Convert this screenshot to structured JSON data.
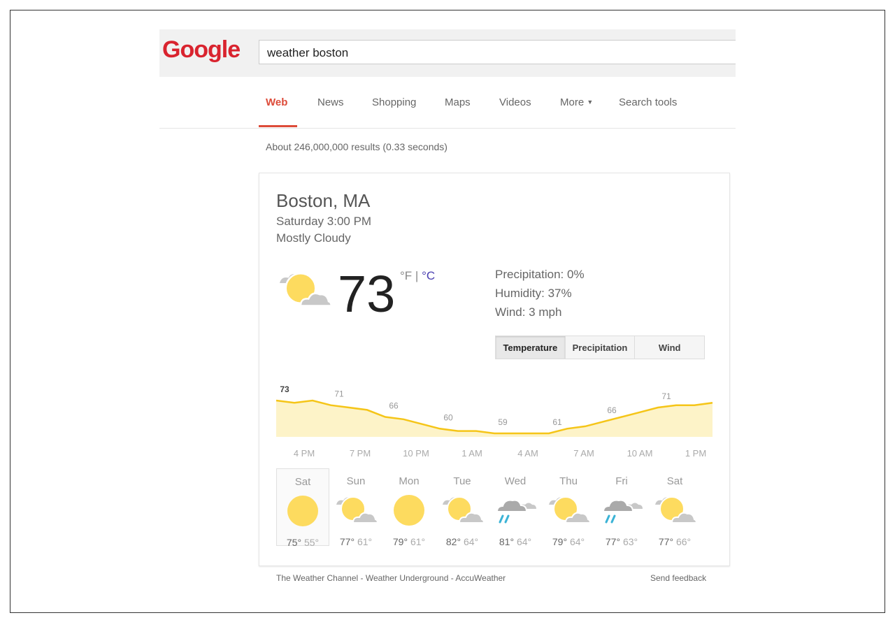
{
  "logo": {
    "text": "Google"
  },
  "search": {
    "query": "weather boston"
  },
  "nav": {
    "items": [
      "Web",
      "News",
      "Shopping",
      "Maps",
      "Videos",
      "More",
      "Search tools"
    ],
    "active": "Web"
  },
  "stats": "About 246,000,000 results (0.33 seconds)",
  "weather": {
    "location": "Boston, MA",
    "datetime": "Saturday 3:00 PM",
    "condition": "Mostly Cloudy",
    "icon": "partly-cloudy-icon",
    "temperature": "73",
    "unit_f": "°F",
    "unit_sep": "|",
    "unit_c": "°C",
    "precipitation": "Precipitation: 0%",
    "humidity": "Humidity: 37%",
    "wind": "Wind: 3 mph",
    "tabs": [
      "Temperature",
      "Precipitation",
      "Wind"
    ],
    "active_tab": "Temperature",
    "colors": {
      "line": "#f5c518",
      "fill": "#fdf3c8",
      "sun": "#fddb5f",
      "cloud": "#c8c8c8",
      "rain": "#3bb3d6"
    }
  },
  "chart_data": {
    "type": "area",
    "hourly": [
      73,
      72,
      73,
      71,
      70,
      69,
      66,
      65,
      63,
      61,
      60,
      60,
      59,
      59,
      59,
      59,
      61,
      62,
      64,
      66,
      68,
      70,
      71,
      71,
      72
    ],
    "labels": [
      {
        "value": "73",
        "bold": true
      },
      {
        "value": "71"
      },
      {
        "value": "66"
      },
      {
        "value": "60"
      },
      {
        "value": "59"
      },
      {
        "value": "61"
      },
      {
        "value": "66"
      },
      {
        "value": "71"
      }
    ],
    "x_ticks": [
      "4 PM",
      "7 PM",
      "10 PM",
      "1 AM",
      "4 AM",
      "7 AM",
      "10 AM",
      "1 PM"
    ]
  },
  "forecast": [
    {
      "day": "Sat",
      "icon": "sun",
      "high": "75°",
      "low": "55°",
      "selected": true
    },
    {
      "day": "Sun",
      "icon": "partly",
      "high": "77°",
      "low": "61°"
    },
    {
      "day": "Mon",
      "icon": "sun",
      "high": "79°",
      "low": "61°"
    },
    {
      "day": "Tue",
      "icon": "partly",
      "high": "82°",
      "low": "64°"
    },
    {
      "day": "Wed",
      "icon": "rain",
      "high": "81°",
      "low": "64°"
    },
    {
      "day": "Thu",
      "icon": "partly",
      "high": "79°",
      "low": "64°"
    },
    {
      "day": "Fri",
      "icon": "rain",
      "high": "77°",
      "low": "63°"
    },
    {
      "day": "Sat",
      "icon": "partly",
      "high": "77°",
      "low": "66°"
    }
  ],
  "footer": {
    "sources": "The Weather Channel - Weather Underground - AccuWeather",
    "feedback": "Send feedback"
  }
}
